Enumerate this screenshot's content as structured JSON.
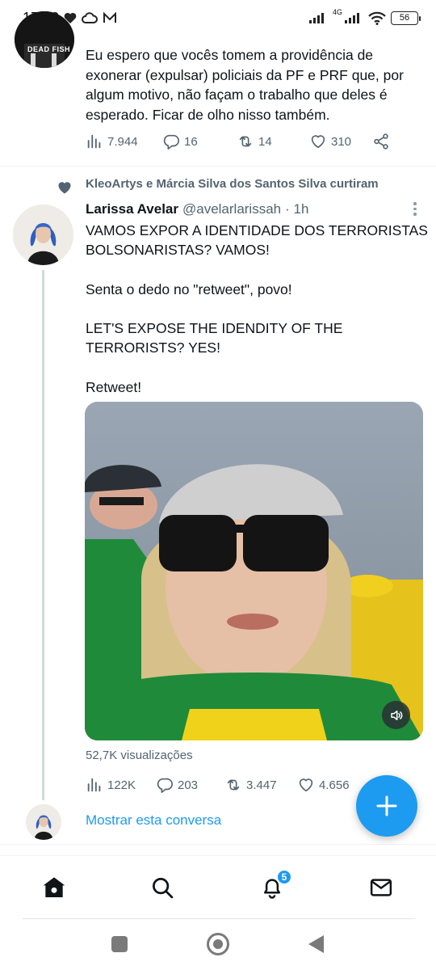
{
  "status_bar": {
    "time": "17:08",
    "network": "4G",
    "battery": "56"
  },
  "tweet_previous": {
    "avatar_text": "DEAD FISH",
    "text": "Eu espero que vocês tomem a providência de exonerar (expulsar) policiais da PF e PRF que, por algum motivo, não façam o trabalho que deles é esperado. Ficar de olho nisso também.",
    "views": "7.944",
    "replies": "16",
    "retweets": "14",
    "likes": "310"
  },
  "tweet_main": {
    "liked_by": "KleoArtys e Márcia Silva dos Santos Silva curtiram",
    "author_name": "Larissa Avelar",
    "author_handle": "@avelarlarissah",
    "time": "· 1h",
    "text": "VAMOS EXPOR A IDENTIDADE DOS TERRORISTAS BOLSONARISTAS? VAMOS!\n\nSenta o dedo no \"retweet\", povo!\n\nLET'S EXPOSE THE IDENDITY OF THE TERRORISTS? YES!\n\nRetweet!",
    "views_label": "52,7K visualizações",
    "views": "122K",
    "replies": "203",
    "retweets": "3.447",
    "likes": "4.656"
  },
  "show_conversation": "Mostrar esta conversa",
  "bottom_nav": {
    "notification_count": "5"
  },
  "colors": {
    "accent": "#1d9bf0",
    "text": "#0f1419",
    "muted": "#536471"
  }
}
